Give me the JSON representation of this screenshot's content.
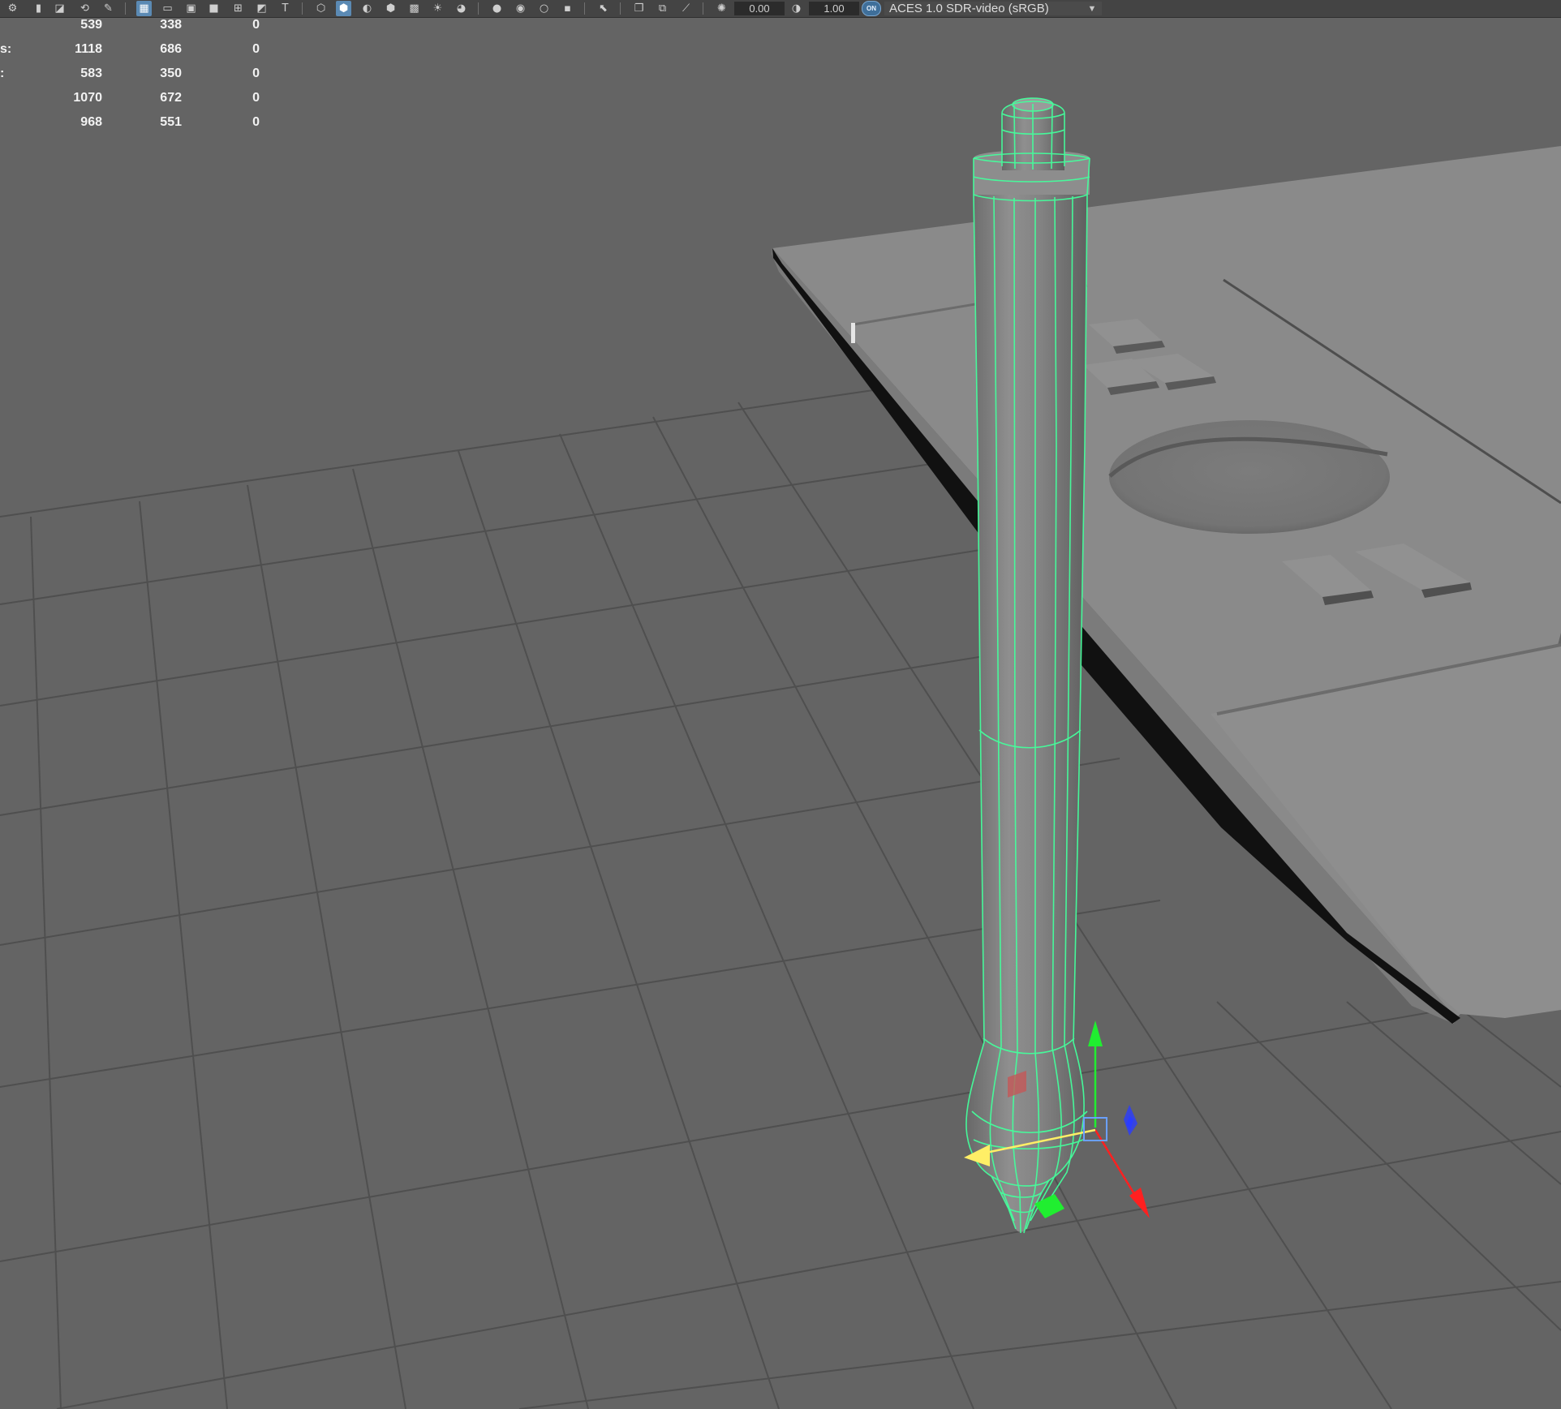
{
  "toolbar": {
    "exposure_value": "0.00",
    "gamma_value": "1.00",
    "color_management_badge": "ON",
    "color_space": "ACES 1.0 SDR-video (sRGB)",
    "icons": [
      "camera-attributes-icon",
      "bookmark-icon",
      "image-plane-icon",
      "2d-pan-zoom-icon",
      "grease-pencil-icon",
      "grid-icon",
      "film-gate-icon",
      "resolution-gate-icon",
      "gate-mask-icon",
      "field-chart-icon",
      "safe-action-icon",
      "safe-title-icon",
      "wireframe-icon",
      "smooth-shade-icon",
      "use-default-material-icon",
      "wireframe-on-shaded-icon",
      "textured-icon",
      "use-all-lights-icon",
      "shadows-icon",
      "screen-space-ao-icon",
      "motion-blur-icon",
      "anti-aliasing-icon",
      "depth-of-field-icon",
      "isolate-select-icon",
      "xray-icon",
      "xray-active-components-icon",
      "xray-joints-icon",
      "exposure-icon",
      "gamma-icon",
      "color-management-icon"
    ]
  },
  "hud": {
    "rows": [
      {
        "label": "",
        "v1": "539",
        "v2": "338",
        "v3": "0"
      },
      {
        "label": "s:",
        "v1": "1118",
        "v2": "686",
        "v3": "0"
      },
      {
        "label": ":",
        "v1": "583",
        "v2": "350",
        "v3": "0"
      },
      {
        "label": "",
        "v1": "1070",
        "v2": "672",
        "v3": "0"
      },
      {
        "label": "",
        "v1": "968",
        "v2": "551",
        "v3": "0"
      }
    ]
  },
  "scene": {
    "selected_object": "stylus",
    "manipulator": "move-tool",
    "colors": {
      "background": "#646464",
      "grid": "#4f4f4f",
      "selection_wire": "#44ff9c",
      "x_axis": "#ff2020",
      "y_axis": "#20ee30",
      "z_axis": "#2b3cff",
      "tablet_surface": "#8a8a8a"
    }
  }
}
